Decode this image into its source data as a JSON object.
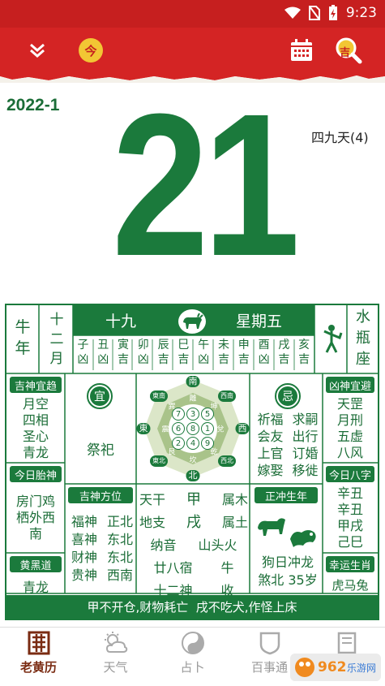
{
  "status": {
    "time": "9:23"
  },
  "toolbar": {
    "today_label": "今",
    "ji_label": "吉"
  },
  "date": {
    "year_month": "2022-1",
    "day": "21",
    "jiu": "四九天(4)"
  },
  "almanac": {
    "gz_month": [
      "牛",
      "年"
    ],
    "lunar_month": [
      "十",
      "二",
      "月"
    ],
    "lunar_day": "十九",
    "weekday": "星期五",
    "zodiac_sign": [
      "水",
      "瓶",
      "座"
    ],
    "hours": [
      {
        "b": "子",
        "l": "凶"
      },
      {
        "b": "丑",
        "l": "凶"
      },
      {
        "b": "寅",
        "l": "吉"
      },
      {
        "b": "卯",
        "l": "凶"
      },
      {
        "b": "辰",
        "l": "吉"
      },
      {
        "b": "巳",
        "l": "吉"
      },
      {
        "b": "午",
        "l": "凶"
      },
      {
        "b": "未",
        "l": "吉"
      },
      {
        "b": "申",
        "l": "吉"
      },
      {
        "b": "酉",
        "l": "凶"
      },
      {
        "b": "戌",
        "l": "吉"
      },
      {
        "b": "亥",
        "l": "吉"
      }
    ],
    "jishen_title": "吉神宜趋",
    "jishen_items": [
      "月空",
      "四相",
      "圣心",
      "青龙"
    ],
    "yi_label": "宜",
    "yi_text": "祭祀",
    "ji_label": "忌",
    "ji_text": [
      "祈福",
      "求嗣",
      "会友",
      "出行",
      "上官",
      "订婚",
      "嫁娶",
      "移徙"
    ],
    "xiongshen_title": "凶神宜避",
    "xiongshen_items": [
      "天罡",
      "月刑",
      "五虚",
      "八风"
    ],
    "taishen_title": "今日胎神",
    "taishen_text": [
      "房门鸡",
      "栖外西",
      "南"
    ],
    "jishen_dir_title": "吉神方位",
    "jishen_dir": [
      {
        "a": "福神",
        "b": "正北"
      },
      {
        "a": "喜神",
        "b": "东北"
      },
      {
        "a": "财神",
        "b": "东北"
      },
      {
        "a": "贵神",
        "b": "西南"
      }
    ],
    "tiangan_label": "天干",
    "tiangan_val": "甲",
    "tiangan_el": "属木",
    "dizhi_label": "地支",
    "dizhi_val": "戌",
    "dizhi_el": "属土",
    "nayin_label": "纳音",
    "nayin_val": "山头火",
    "xiu_label": "廿八宿",
    "xiu_val": "牛",
    "shen_label": "十二神",
    "shen_val": "收",
    "huangdao_title": "黄黑道",
    "huangdao_val": "青龙",
    "chong_title": "正冲生年",
    "chong_text": [
      "狗日冲龙",
      "煞北",
      "35岁"
    ],
    "bazi_title": "今日八字",
    "bazi": [
      "辛丑",
      "辛丑",
      "甲戌",
      "己巳"
    ],
    "lucky_title": "幸运生肖",
    "lucky_val": "虎马兔",
    "footer": "甲不开仓,财物耗亡  戌不吃犬,作怪上床",
    "compass": {
      "south": "南",
      "north": "北",
      "east": "東",
      "west": "西",
      "ne": "東北",
      "nw": "西北",
      "se": "東南",
      "sw": "西南",
      "trigrams": [
        "巽",
        "離",
        "坤",
        "震",
        "兌",
        "艮",
        "坎",
        "乾"
      ],
      "grid": [
        "7",
        "3",
        "5",
        "6",
        "8",
        "1",
        "2",
        "4",
        "9"
      ]
    }
  },
  "tabs": [
    {
      "label": "老黄历",
      "icon": "almanac-icon"
    },
    {
      "label": "天气",
      "icon": "weather-icon"
    },
    {
      "label": "占卜",
      "icon": "taiji-icon"
    },
    {
      "label": "百事通",
      "icon": "shield-icon"
    },
    {
      "label": "",
      "icon": "more-icon"
    }
  ],
  "watermark": "962.net 乐游网",
  "colors": {
    "red": "#d42424",
    "green": "#1b7a3c",
    "yellow": "#f2c634"
  }
}
